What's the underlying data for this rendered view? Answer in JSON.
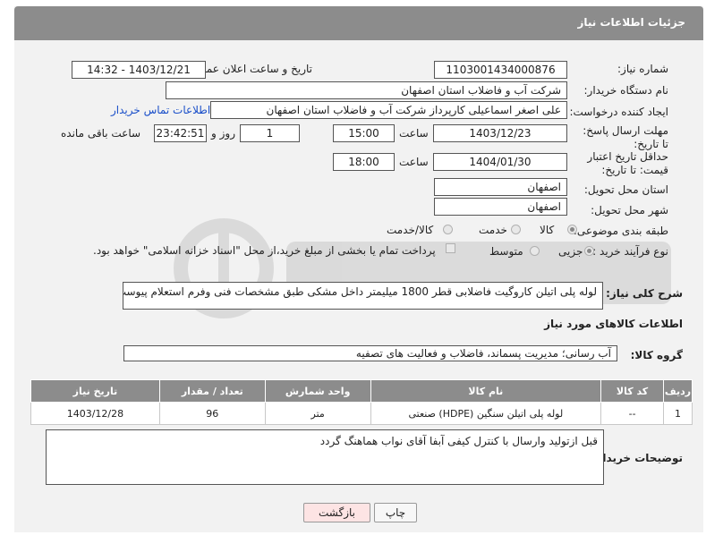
{
  "header": {
    "title": "جزئیات اطلاعات نیاز"
  },
  "form": {
    "need_number_label": "شماره نیاز:",
    "need_number": "1103001434000876",
    "announce_label": "تاریخ و ساعت اعلان عمومی:",
    "announce_value": "1403/12/21 - 14:32",
    "buyer_org_label": "نام دستگاه خریدار:",
    "buyer_org": "شرکت آب و فاضلاب استان اصفهان",
    "creator_label": "ایجاد کننده درخواست:",
    "creator": "علی اصغر اسماعیلی کارپرداز شرکت آب و فاضلاب استان اصفهان",
    "contact_link": "اطلاعات تماس خریدار",
    "reply_deadline_label": "مهلت ارسال پاسخ: تا تاریخ:",
    "reply_date": "1403/12/23",
    "time_label": "ساعت",
    "reply_time": "15:00",
    "days_value": "1",
    "days_label": "روز و",
    "remaining_time": "23:42:51",
    "remaining_label": "ساعت باقی مانده",
    "price_validity_label": "حداقل تاریخ اعتبار قیمت: تا تاریخ:",
    "price_date": "1404/01/30",
    "price_time": "18:00",
    "province_label": "استان محل تحویل:",
    "province": "اصفهان",
    "city_label": "شهر محل تحویل:",
    "city": "اصفهان",
    "category_label": "طبقه بندی موضوعی:",
    "category_options": [
      "کالا",
      "خدمت",
      "کالا/خدمت"
    ],
    "process_label": "نوع فرآیند خرید :",
    "process_options": [
      "جزیی",
      "متوسط"
    ],
    "payment_note": "پرداخت تمام یا بخشی از مبلغ خرید،از محل \"اسناد خزانه اسلامی\" خواهد بود."
  },
  "description": {
    "label": "شرح کلی نیاز:",
    "text": "لوله پلی اتیلن کاروگیت فاضلابی قطر 1800 میلیمتر  داخل مشکی طبق مشخصات فنی وفرم استعلام پیوست"
  },
  "goods": {
    "section_title": "اطلاعات کالاهای مورد نیاز",
    "group_label": "گروه کالا:",
    "group_value": "آب رسانی؛ مدیریت پسماند، فاضلاب و فعالیت های تصفیه",
    "columns": [
      "ردیف",
      "کد کالا",
      "نام کالا",
      "واحد شمارش",
      "تعداد / مقدار",
      "تاریخ نیاز"
    ],
    "rows": [
      [
        "1",
        "--",
        "لوله پلی اتیلن سنگین (HDPE) صنعتی",
        "متر",
        "96",
        "1403/12/28"
      ]
    ]
  },
  "buyer_notes": {
    "label": "توضیحات خریدار:",
    "text": "قبل ازتولید وارسال با کنترل کیفی آبفا آقای نواب هماهنگ گردد"
  },
  "buttons": {
    "print": "چاپ",
    "back": "بازگشت"
  },
  "colors": {
    "header_bg": "#8c8c8c",
    "link": "#1a4fc9",
    "back_button_bg": "#fde4e4"
  }
}
